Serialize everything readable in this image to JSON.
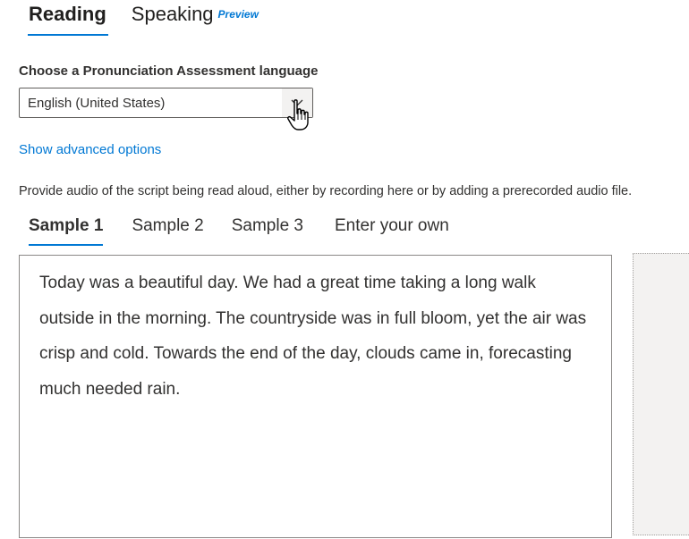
{
  "top_tabs": {
    "reading": "Reading",
    "speaking": "Speaking",
    "preview_badge": "Preview"
  },
  "language": {
    "label": "Choose a Pronunciation Assessment language",
    "selected": "English (United States)",
    "chevron_icon": "chevron-down-icon"
  },
  "advanced_link": "Show advanced options",
  "instructions": "Provide audio of the script being read aloud, either by recording here or by adding a prerecorded audio file.",
  "sample_tabs": [
    {
      "label": "Sample 1",
      "active": true
    },
    {
      "label": "Sample 2",
      "active": false
    },
    {
      "label": "Sample 3",
      "active": false
    },
    {
      "label": "Enter your own",
      "active": false
    }
  ],
  "script": "Today was a beautiful day. We had a great time taking a long walk outside in the morning. The countryside was in full bloom, yet the air was crisp and cold. Towards the end of the day, clouds came in, forecasting much needed rain.",
  "colors": {
    "accent": "#0078d4",
    "text": "#323130",
    "border": "#8a8886"
  }
}
